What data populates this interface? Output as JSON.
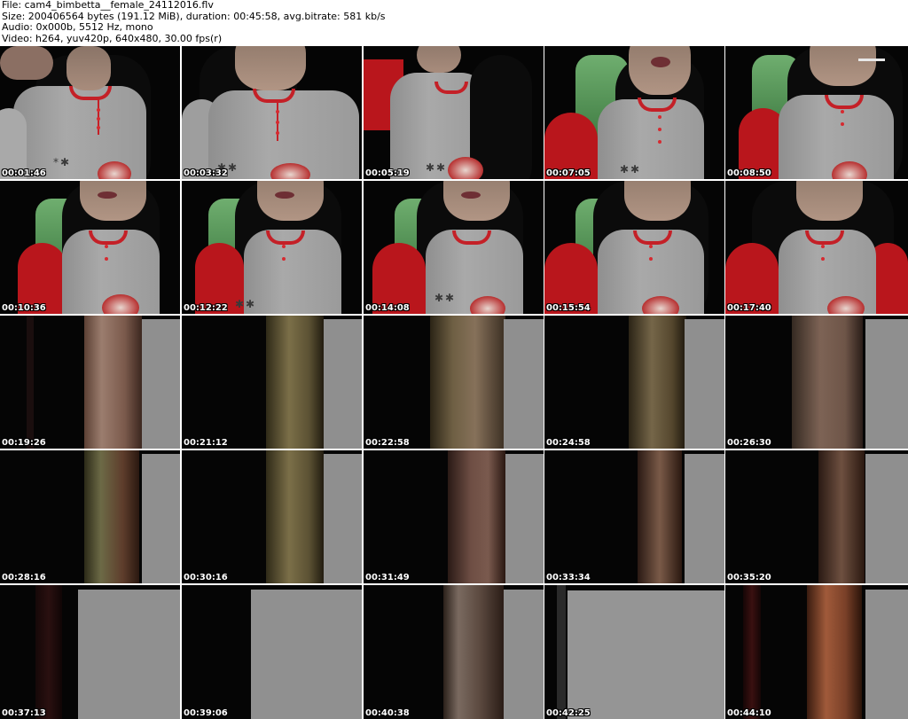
{
  "header": {
    "line1": "File: cam4_bimbetta__female_24112016.flv",
    "line2": "Size: 200406564 bytes (191.12 MiB), duration: 00:45:58, avg.bitrate: 581 kb/s",
    "line3": "Audio: 0x000b, 5512 Hz, mono",
    "line4": "Video: h264, yuv420p, 640x480, 30.00 fps(r)"
  },
  "thumbnails": [
    {
      "ts": "00:01:46"
    },
    {
      "ts": "00:03:32"
    },
    {
      "ts": "00:05:19"
    },
    {
      "ts": "00:07:05"
    },
    {
      "ts": "00:08:50"
    },
    {
      "ts": "00:10:36"
    },
    {
      "ts": "00:12:22"
    },
    {
      "ts": "00:14:08"
    },
    {
      "ts": "00:15:54"
    },
    {
      "ts": "00:17:40"
    },
    {
      "ts": "00:19:26"
    },
    {
      "ts": "00:21:12"
    },
    {
      "ts": "00:22:58"
    },
    {
      "ts": "00:24:58"
    },
    {
      "ts": "00:26:30"
    },
    {
      "ts": "00:28:16"
    },
    {
      "ts": "00:30:16"
    },
    {
      "ts": "00:31:49"
    },
    {
      "ts": "00:33:34"
    },
    {
      "ts": "00:35:20"
    },
    {
      "ts": "00:37:13"
    },
    {
      "ts": "00:39:06"
    },
    {
      "ts": "00:40:38"
    },
    {
      "ts": "00:42:25"
    },
    {
      "ts": "00:44:10"
    }
  ]
}
